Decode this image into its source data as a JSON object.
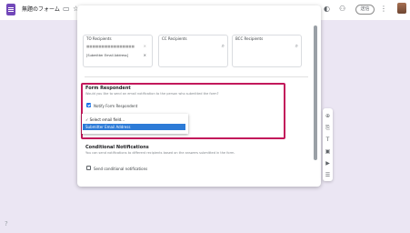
{
  "topbar": {
    "form_title": "無題のフォーム",
    "folder_icon": "folder-icon",
    "star_icon": "star-icon",
    "send_label": "送信"
  },
  "dialog": {
    "recipients": [
      {
        "label": "TO Recipients",
        "chip_text": "■■■■■■■■■■■■■■■■",
        "chip2_text": "[Submitter Email Address]"
      },
      {
        "label": "CC Recipients"
      },
      {
        "label": "BCC Recipients"
      }
    ],
    "respondent": {
      "title": "Form Respondent",
      "description": "Would you like to send an email notification to the person who submitted the form?",
      "checkbox_label": "Notify Form Respondent",
      "checked": true,
      "dropdown_options": [
        "✓ Select email field...",
        "Submitter Email Address"
      ],
      "highlighted_index": 1
    },
    "conditional": {
      "title": "Conditional Notifications",
      "description": "You can send notifications to different recipients based on the answers submitted in the form.",
      "checkbox_label": "Send conditional notifications",
      "checked": false
    }
  },
  "right_rail": [
    "add-question-icon",
    "import-questions-icon",
    "add-title-icon",
    "add-image-icon",
    "add-video-icon",
    "add-section-icon"
  ],
  "colors": {
    "brand": "#7248b9",
    "highlight_border": "#c2185b",
    "selected_option": "#2d7bd7"
  }
}
